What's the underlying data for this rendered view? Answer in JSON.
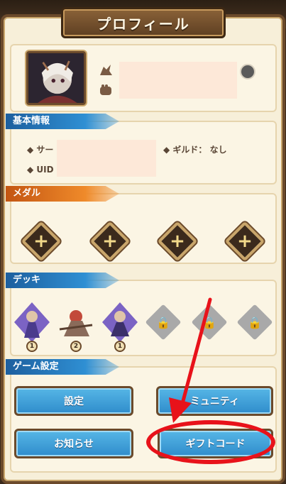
{
  "header": {
    "title": "プロフィール"
  },
  "profile": {
    "avatar": "character-portrait",
    "edit_icon": "edit-icon"
  },
  "sections": {
    "basic_info": "基本情報",
    "medal": "メダル",
    "deck": "デッキ",
    "game_settings": "ゲーム設定"
  },
  "basic_info": {
    "server_label": "サー",
    "uid_label": "UID",
    "guild_label": "ギルド：",
    "guild_value": "なし"
  },
  "medal_slots": [
    "empty",
    "empty",
    "empty",
    "empty"
  ],
  "deck": {
    "characters": [
      {
        "rank": "1"
      },
      {
        "rank": "2"
      },
      {
        "rank": "1"
      }
    ],
    "locked_slots": 3
  },
  "buttons": {
    "settings": "設定",
    "community": "ミュニティ",
    "notice": "お知らせ",
    "gift_code": "ギフトコード"
  },
  "colors": {
    "panel": "#f7efd9",
    "frame": "#6b4a2b",
    "button": "#2f8ccb",
    "banner_blue": "#2f8fd3",
    "banner_orange": "#ef8a2a",
    "annotation": "#e8121a"
  }
}
